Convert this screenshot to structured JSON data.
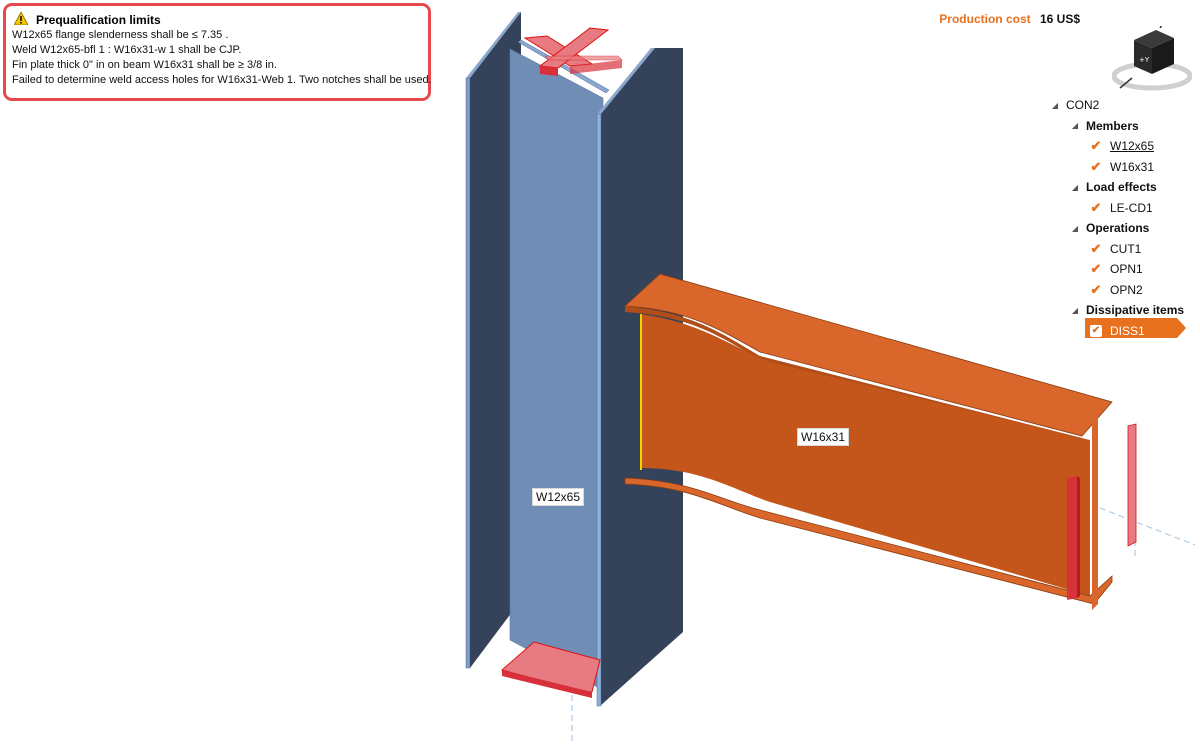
{
  "warning": {
    "title": "Prequalification limits",
    "lines": [
      "W12x65 flange slenderness shall be ≤ 7.35 .",
      "Weld W12x65-bfl 1 : W16x31-w 1 shall be CJP.",
      "Fin plate thick 0\" in on beam W16x31 shall be ≥ 3/8 in.",
      "Failed to determine weld access holes for W16x31-Web 1. Two notches shall be used."
    ]
  },
  "production_cost": {
    "label": "Production cost",
    "value": "16 US$"
  },
  "viewcube": {
    "face_label": "+Y"
  },
  "tree": {
    "root": "CON2",
    "groups": [
      {
        "label": "Members",
        "items": [
          "W12x65",
          "W16x31"
        ]
      },
      {
        "label": "Load effects",
        "items": [
          "LE-CD1"
        ]
      },
      {
        "label": "Operations",
        "items": [
          "CUT1",
          "OPN1",
          "OPN2"
        ]
      },
      {
        "label": "Dissipative items",
        "items": [
          "DISS1"
        ]
      }
    ]
  },
  "model_labels": {
    "column": "W12x65",
    "beam": "W16x31"
  },
  "colors": {
    "accent": "#e8711f",
    "column_face": "#6f8db5",
    "column_side": "#34435a",
    "beam": "#c4561c",
    "highlight_red": "#e0303a",
    "warning_border": "#e5484d"
  }
}
